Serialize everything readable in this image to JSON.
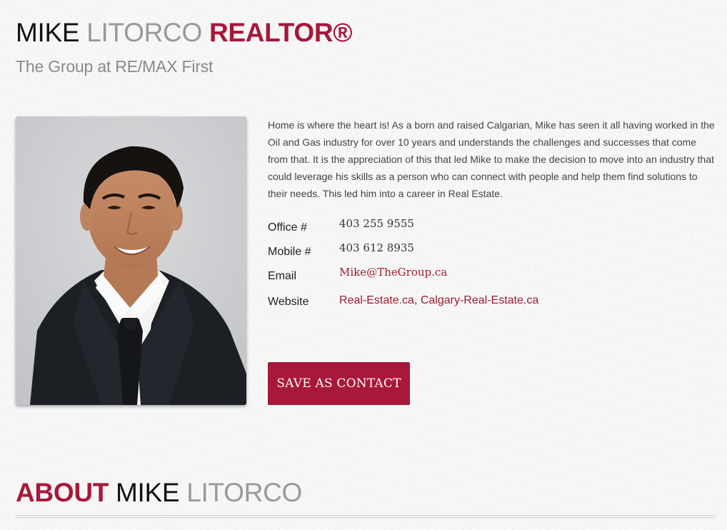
{
  "header": {
    "first_name": "MIKE",
    "last_name": "LITORCO",
    "title": "REALTOR®",
    "subtitle": "The Group at RE/MAX First"
  },
  "photo": {
    "alt": "Mike Litorco"
  },
  "bio": "Home is where the heart is! As a born and raised Calgarian, Mike has seen it all having worked in the Oil and Gas industry for over 10 years and understands the challenges and successes that come from that. It is the appreciation of this that led Mike to make the decision to move into an industry that could leverage his skills as a person who can connect with people and help them find solutions to their needs. This led him into a career in Real Estate.",
  "contact": {
    "office_label": "Office #",
    "office_value": "403 255 9555",
    "mobile_label": "Mobile #",
    "mobile_value": "403 612 8935",
    "email_label": "Email",
    "email_value": "Mike@TheGroup.ca",
    "website_label": "Website",
    "website_1": "Real-Estate.ca",
    "website_sep": ",",
    "website_2": "Calgary-Real-Estate.ca"
  },
  "save_button": "SAVE AS CONTACT",
  "about": {
    "word": "ABOUT",
    "first_name": "MIKE",
    "last_name": "LITORCO"
  },
  "colors": {
    "accent": "#a8183a",
    "link": "#9b1b30",
    "background": "#f7f7f7"
  }
}
